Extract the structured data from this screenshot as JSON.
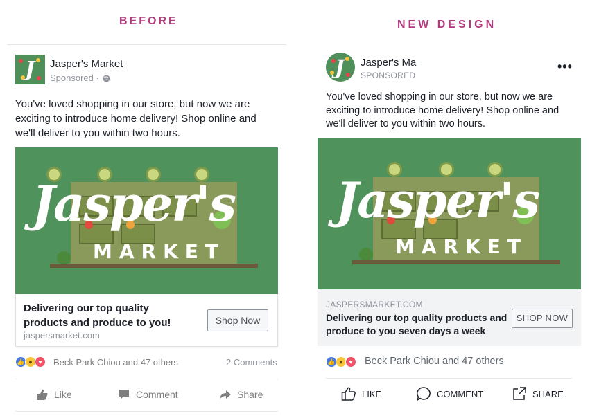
{
  "headings": {
    "before": "BEFORE",
    "after": "NEW DESIGN"
  },
  "before": {
    "page_name": "Jasper's Market",
    "sponsored": "Sponsored ·",
    "text": "You've loved shopping in our store, but now we are exciting to introduce home delivery! Shop online and we'll deliver to you within two hours.",
    "image_script": "Jasper's",
    "image_market": "MARKET",
    "headline": "Delivering our top quality products and produce to you!",
    "domain": "jaspersmarket.com",
    "cta": "Shop Now",
    "reaction_text": "Beck Park Chiou and 47 others",
    "comments": "2 Comments",
    "actions": {
      "like": "Like",
      "comment": "Comment",
      "share": "Share"
    }
  },
  "after": {
    "page_name": "Jasper's Ma",
    "sponsored": "SPONSORED",
    "text": "You've loved shopping in our store, but now we are exciting to introduce home delivery! Shop online and we'll deliver to you within two hours.",
    "image_script": "Jasper's",
    "image_market": "MARKET",
    "domain": "JASPERSMARKET.COM",
    "headline": "Delivering our top quality products and produce to you seven days a week",
    "cta": "SHOP NOW",
    "reaction_text": "Beck Park Chiou and 47 others",
    "actions": {
      "like": "LIKE",
      "comment": "COMMENT",
      "share": "SHARE"
    }
  },
  "colors": {
    "heading": "#b43a7e",
    "brand_green": "#4f925c",
    "facebook_blue": "#4a7ae8"
  }
}
